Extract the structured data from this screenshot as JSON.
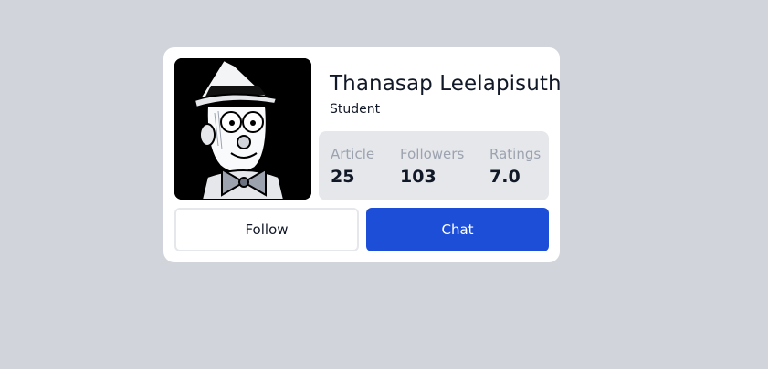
{
  "profile": {
    "name": "Thanasap Leelapisuth",
    "role": "Student"
  },
  "stats": [
    {
      "label": "Article",
      "value": "25"
    },
    {
      "label": "Followers",
      "value": "103"
    },
    {
      "label": "Ratings",
      "value": "7.0"
    }
  ],
  "actions": {
    "follow_label": "Follow",
    "chat_label": "Chat"
  },
  "colors": {
    "background": "#d1d5db",
    "card": "#ffffff",
    "stats_panel": "#e5e7eb",
    "primary": "#1d4ed8"
  }
}
